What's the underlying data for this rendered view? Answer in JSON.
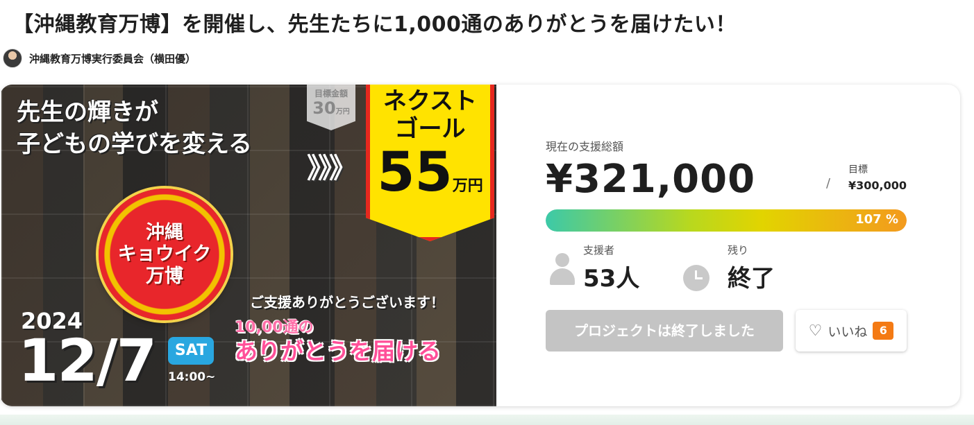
{
  "page": {
    "title": "【沖縄教育万博】を開催し、先生たちに1,000通のありがとうを届けたい！",
    "owner_name": "沖縄教育万博実行委員会（横田優）"
  },
  "hero": {
    "headline": "先生の輝きが\n子どもの学びを変える",
    "arrows": "》》》",
    "old_goal_label": "目標金額",
    "old_goal_amount": "30",
    "old_goal_unit": "万円",
    "next_goal_label": "ネクスト\nゴール",
    "next_goal_amount": "55",
    "next_goal_unit": "万円",
    "logo_text": "沖縄\nキョウイク\n万博",
    "thanks_line": "ご支援ありがとうございます！",
    "pink_sub": "10,00通の",
    "pink_main": "ありがとうを届ける",
    "date_year": "2024",
    "date_day": "12/7",
    "date_dow": "SAT",
    "date_time": "14:00~"
  },
  "stats": {
    "raised_label": "現在の支援総額",
    "raised_amount": "¥321,000",
    "goal_slash": "/",
    "goal_label": "目標",
    "goal_value": "¥300,000",
    "progress_percent": 107,
    "progress_text": "107 %",
    "backers_label": "支援者",
    "backers_value": "53人",
    "remaining_label": "残り",
    "remaining_value": "終了"
  },
  "actions": {
    "ended_label": "プロジェクトは終了しました",
    "like_label": "いいね",
    "like_count": "6"
  },
  "colors": {
    "progress_start": "#3cc9a8",
    "progress_end": "#f39a1e",
    "like_badge": "#f47a14",
    "ended_button": "#c4c4c4"
  },
  "icons": [
    "owner-avatar",
    "person-icon",
    "clock-icon",
    "heart-icon"
  ]
}
